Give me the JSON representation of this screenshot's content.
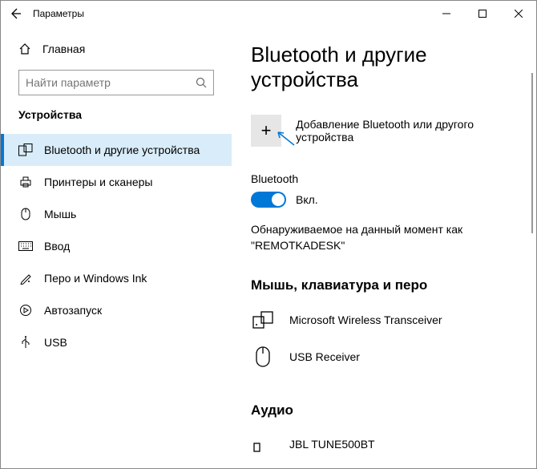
{
  "window": {
    "title": "Параметры"
  },
  "sidebar": {
    "home_label": "Главная",
    "search_placeholder": "Найти параметр",
    "section_header": "Устройства",
    "items": [
      {
        "label": "Bluetooth и другие устройства"
      },
      {
        "label": "Принтеры и сканеры"
      },
      {
        "label": "Мышь"
      },
      {
        "label": "Ввод"
      },
      {
        "label": "Перо и Windows Ink"
      },
      {
        "label": "Автозапуск"
      },
      {
        "label": "USB"
      }
    ]
  },
  "content": {
    "title": "Bluetooth и другие устройства",
    "add_device_label": "Добавление Bluetooth или другого устройства",
    "bluetooth": {
      "heading": "Bluetooth",
      "state_label": "Вкл.",
      "discoverable_text": "Обнаруживаемое на данный момент как \"REMOTKADESK\""
    },
    "sections": [
      {
        "heading": "Мышь, клавиатура и перо",
        "devices": [
          {
            "name": "Microsoft Wireless Transceiver"
          },
          {
            "name": "USB Receiver"
          }
        ]
      },
      {
        "heading": "Аудио",
        "devices": [
          {
            "name": "JBL TUNE500BT"
          }
        ]
      }
    ]
  }
}
